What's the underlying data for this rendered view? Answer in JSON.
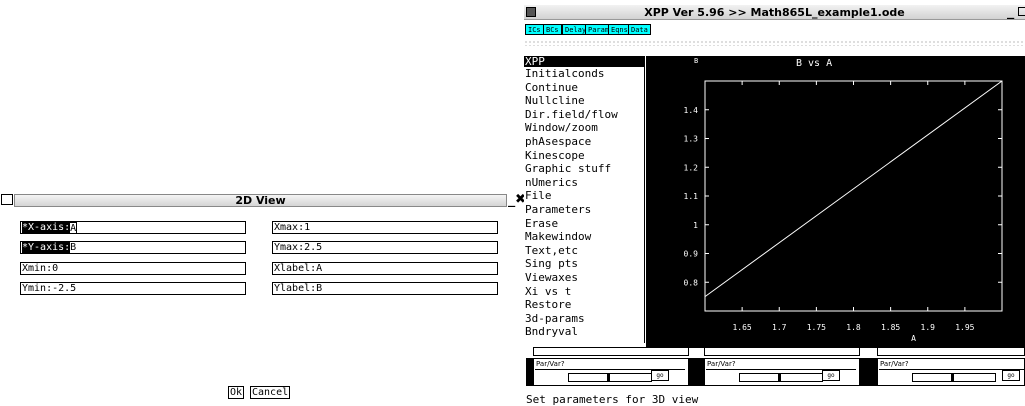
{
  "dialog": {
    "title": "2D View",
    "fields": [
      {
        "hl": "*X-axis:",
        "value": "A"
      },
      {
        "hl": "*Y-axis:",
        "value": "B"
      },
      {
        "hl": "",
        "value": "Xmin:0"
      },
      {
        "hl": "",
        "value": "Ymin:-2.5"
      },
      {
        "hl": "",
        "value": "Xmax:1"
      },
      {
        "hl": "",
        "value": "Ymax:2.5"
      },
      {
        "hl": "",
        "value": "Xlabel:A"
      },
      {
        "hl": "",
        "value": "Ylabel:B"
      }
    ],
    "ok_label": "Ok",
    "cancel_label": "Cancel",
    "minimize_glyph": "_",
    "close_glyph": "✖"
  },
  "xpp": {
    "title": "XPP Ver 5.96 >> Math865L_example1.ode",
    "toolbar": [
      "ICs",
      "BCs",
      "Delay",
      "Param",
      "Eqns",
      "Data"
    ],
    "menu": [
      "XPP",
      "Initialconds",
      "Continue",
      "Nullcline",
      "Dir.field/flow",
      "Window/zoom",
      "phAsespace",
      "Kinescope",
      "Graphic stuff",
      "nUmerics",
      "File",
      "Parameters",
      "Erase",
      "Makewindow",
      "Text,etc",
      "Sing pts",
      "Viewaxes",
      "Xi vs t",
      "Restore",
      "3d-params",
      "Bndryval"
    ],
    "graph_title": "B vs A",
    "graph_marker": "B",
    "parvar": [
      {
        "label": "Par/Var?",
        "go": "go",
        "knob": 0.47
      },
      {
        "label": "Par/Var?",
        "go": "go",
        "knob": 0.47
      },
      {
        "label": "Par/Var?",
        "go": "go",
        "knob": 0.47
      }
    ],
    "status": "Set parameters for 3D view",
    "minimize_glyph": "_"
  },
  "chart_data": {
    "type": "line",
    "title": "B vs A",
    "xlabel": "A",
    "ylabel": "",
    "xlim": [
      1.6,
      2.0
    ],
    "ylim": [
      0.7,
      1.5
    ],
    "x_ticks": [
      "1.65",
      "1.7",
      "1.75",
      "1.8",
      "1.85",
      "1.9",
      "1.95"
    ],
    "y_ticks": [
      "0.8",
      "0.9",
      "1",
      "1.1",
      "1.2",
      "1.3",
      "1.4"
    ],
    "series": [
      {
        "x": [
          1.6,
          2.0
        ],
        "y": [
          0.75,
          1.5
        ]
      }
    ],
    "line_color": "#ffffff",
    "background": "#000000"
  }
}
